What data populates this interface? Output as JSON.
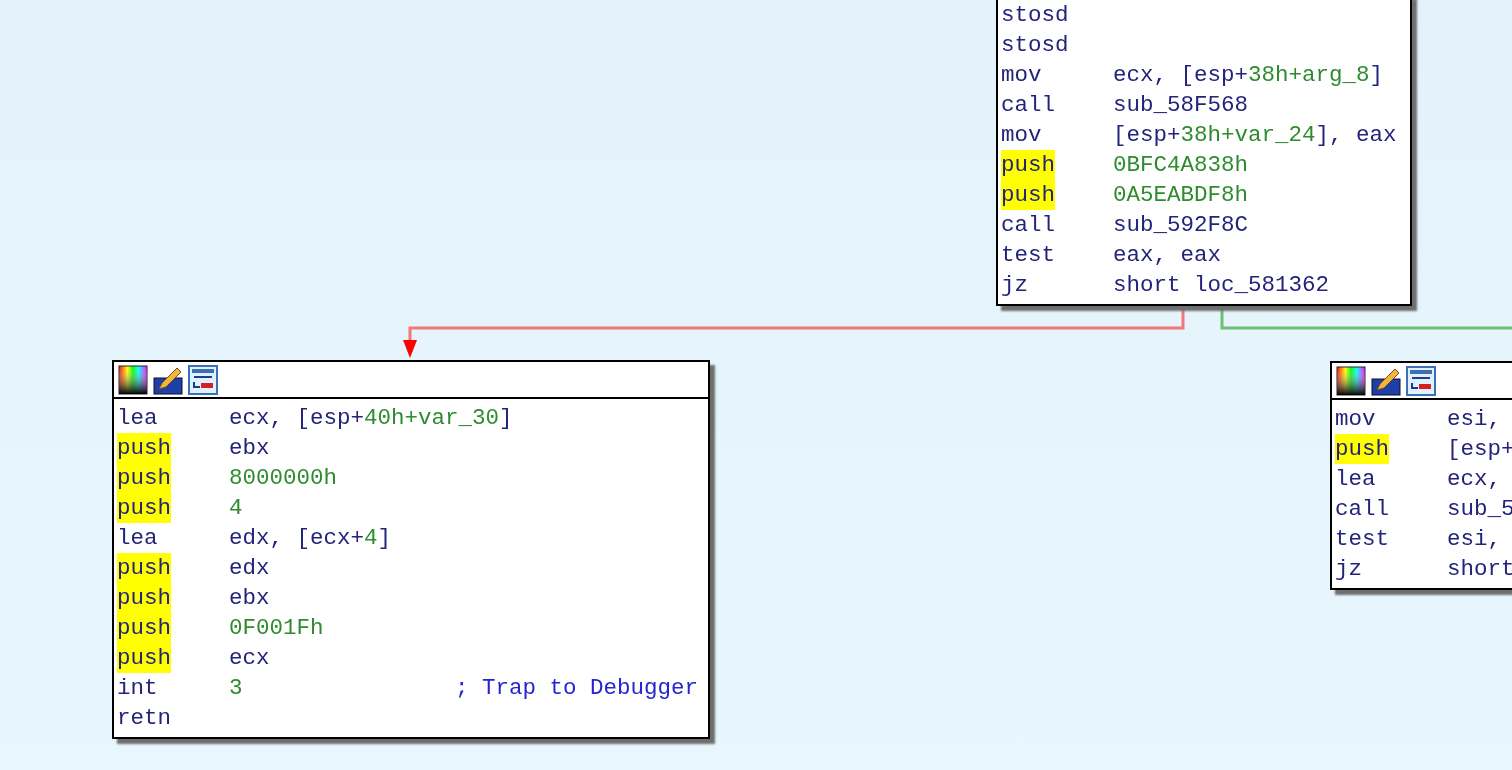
{
  "nodes": [
    {
      "toolbar": false,
      "lines": [
        {
          "mnemonic": "stosd",
          "highlighted": false
        },
        {
          "mnemonic": "stosd",
          "highlighted": false
        },
        {
          "mnemonic": "mov",
          "highlighted": false,
          "operand": [
            {
              "kind": "text",
              "text": "ecx, [esp+"
            },
            {
              "kind": "const",
              "text": "38h+arg_8"
            },
            {
              "kind": "text",
              "text": "]"
            }
          ]
        },
        {
          "mnemonic": "call",
          "highlighted": false,
          "operand": [
            {
              "kind": "text",
              "text": "sub_58F568"
            }
          ]
        },
        {
          "mnemonic": "mov",
          "highlighted": false,
          "operand": [
            {
              "kind": "text",
              "text": "[esp+"
            },
            {
              "kind": "const",
              "text": "38h+var_24"
            },
            {
              "kind": "text",
              "text": "], eax"
            }
          ]
        },
        {
          "mnemonic": "push",
          "highlighted": true,
          "operand": [
            {
              "kind": "const",
              "text": "0BFC4A838h"
            }
          ]
        },
        {
          "mnemonic": "push",
          "highlighted": true,
          "operand": [
            {
              "kind": "const",
              "text": "0A5EABDF8h"
            }
          ]
        },
        {
          "mnemonic": "call",
          "highlighted": false,
          "operand": [
            {
              "kind": "text",
              "text": "sub_592F8C"
            }
          ]
        },
        {
          "mnemonic": "test",
          "highlighted": false,
          "operand": [
            {
              "kind": "text",
              "text": "eax, eax"
            }
          ]
        },
        {
          "mnemonic": "jz",
          "highlighted": false,
          "operand": [
            {
              "kind": "text",
              "text": "short loc_581362"
            }
          ]
        }
      ]
    },
    {
      "toolbar": true,
      "lines": [
        {
          "mnemonic": "lea",
          "highlighted": false,
          "operand": [
            {
              "kind": "text",
              "text": "ecx, [esp+"
            },
            {
              "kind": "const",
              "text": "40h+var_30"
            },
            {
              "kind": "text",
              "text": "]"
            }
          ]
        },
        {
          "mnemonic": "push",
          "highlighted": true,
          "operand": [
            {
              "kind": "text",
              "text": "ebx"
            }
          ]
        },
        {
          "mnemonic": "push",
          "highlighted": true,
          "operand": [
            {
              "kind": "const",
              "text": "8000000h"
            }
          ]
        },
        {
          "mnemonic": "push",
          "highlighted": true,
          "operand": [
            {
              "kind": "const",
              "text": "4"
            }
          ]
        },
        {
          "mnemonic": "lea",
          "highlighted": false,
          "operand": [
            {
              "kind": "text",
              "text": "edx, [ecx+"
            },
            {
              "kind": "const",
              "text": "4"
            },
            {
              "kind": "text",
              "text": "]"
            }
          ]
        },
        {
          "mnemonic": "push",
          "highlighted": true,
          "operand": [
            {
              "kind": "text",
              "text": "edx"
            }
          ]
        },
        {
          "mnemonic": "push",
          "highlighted": true,
          "operand": [
            {
              "kind": "text",
              "text": "ebx"
            }
          ]
        },
        {
          "mnemonic": "push",
          "highlighted": true,
          "operand": [
            {
              "kind": "const",
              "text": "0F001Fh"
            }
          ]
        },
        {
          "mnemonic": "push",
          "highlighted": true,
          "operand": [
            {
              "kind": "text",
              "text": "ecx"
            }
          ]
        },
        {
          "mnemonic": "int",
          "highlighted": false,
          "operand": [
            {
              "kind": "const",
              "text": "3"
            }
          ],
          "comment": "; Trap to Debugger"
        },
        {
          "mnemonic": "retn",
          "highlighted": false
        }
      ]
    },
    {
      "toolbar": true,
      "lines": [
        {
          "mnemonic": "mov",
          "highlighted": false,
          "operand": [
            {
              "kind": "text",
              "text": "esi,"
            }
          ]
        },
        {
          "mnemonic": "push",
          "highlighted": true,
          "operand": [
            {
              "kind": "text",
              "text": "[esp+"
            }
          ]
        },
        {
          "mnemonic": "lea",
          "highlighted": false,
          "operand": [
            {
              "kind": "text",
              "text": "ecx,"
            }
          ]
        },
        {
          "mnemonic": "call",
          "highlighted": false,
          "operand": [
            {
              "kind": "text",
              "text": "sub_5"
            }
          ]
        },
        {
          "mnemonic": "test",
          "highlighted": false,
          "operand": [
            {
              "kind": "text",
              "text": "esi,"
            }
          ]
        },
        {
          "mnemonic": "jz",
          "highlighted": false,
          "operand": [
            {
              "kind": "text",
              "text": "short"
            }
          ]
        }
      ]
    }
  ],
  "edges": [
    {
      "kind": "false",
      "color": "#f07878"
    },
    {
      "kind": "true",
      "color": "#6fbf73"
    }
  ]
}
